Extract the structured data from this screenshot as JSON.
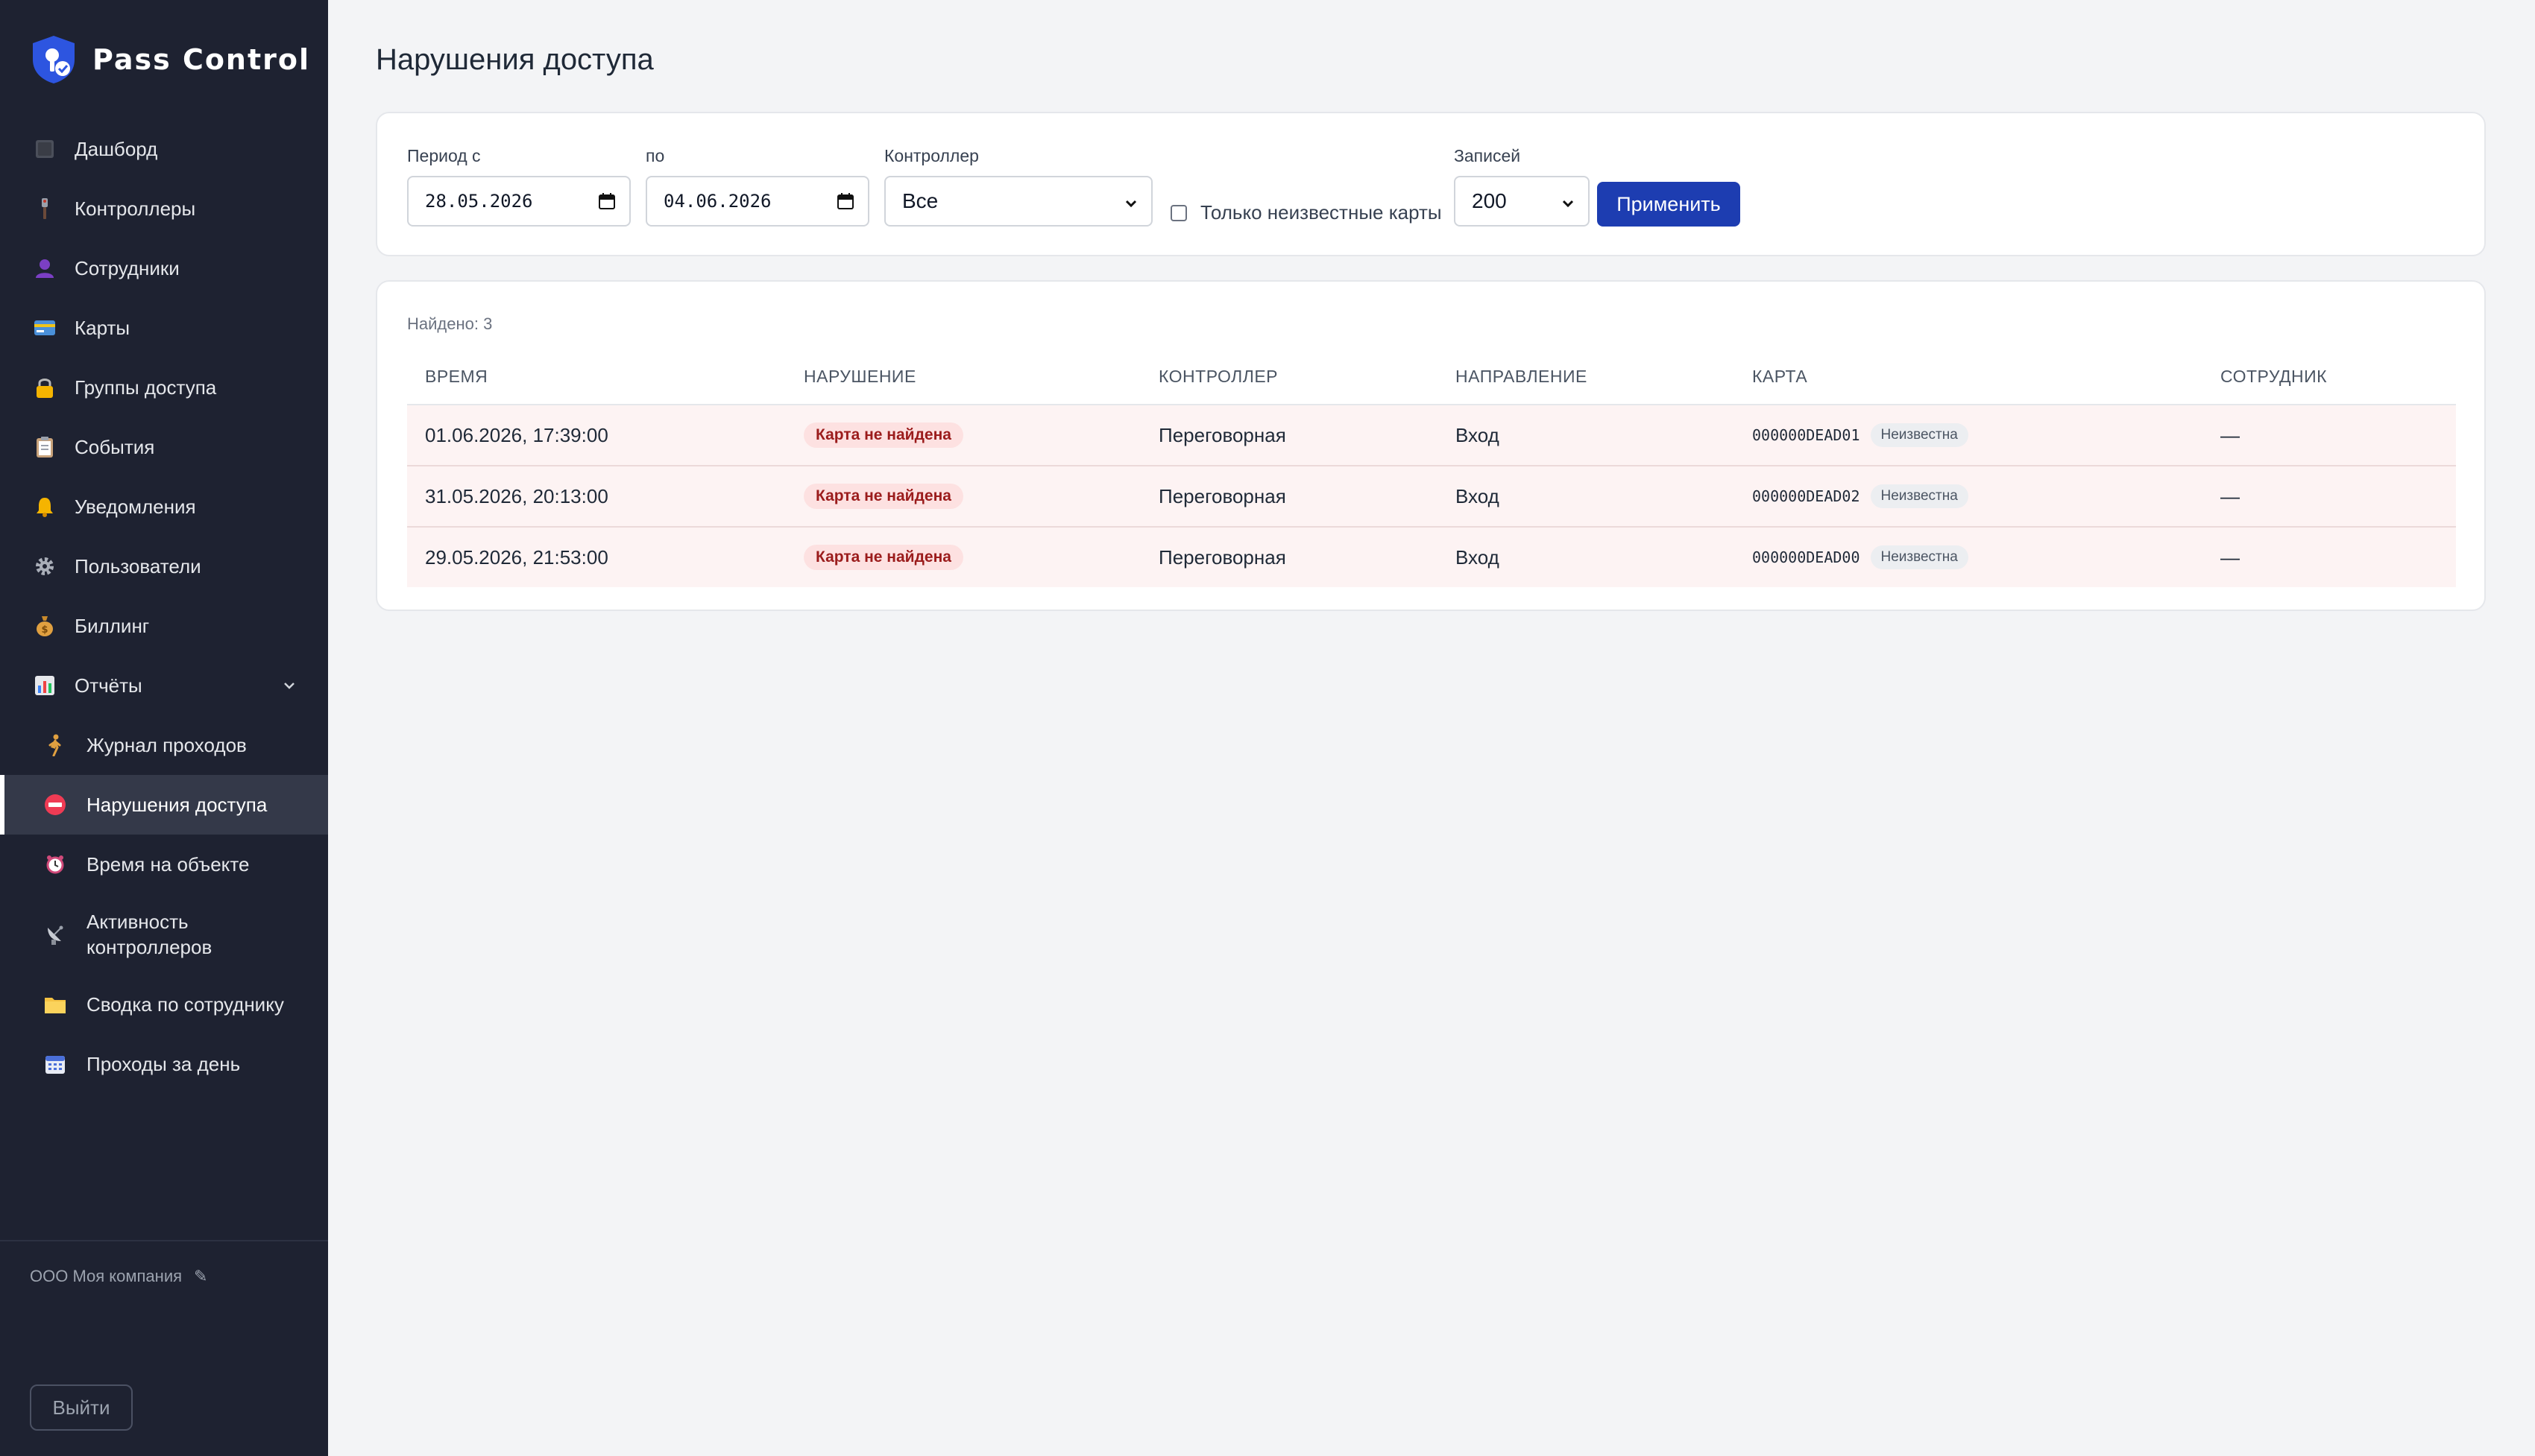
{
  "app": {
    "name": "Pass Control"
  },
  "sidebar": {
    "items": [
      {
        "label": "Дашборд",
        "icon": "dashboard-icon"
      },
      {
        "label": "Контроллеры",
        "icon": "controller-icon"
      },
      {
        "label": "Сотрудники",
        "icon": "user-icon"
      },
      {
        "label": "Карты",
        "icon": "card-icon"
      },
      {
        "label": "Группы доступа",
        "icon": "lock-icon"
      },
      {
        "label": "События",
        "icon": "clipboard-icon"
      },
      {
        "label": "Уведомления",
        "icon": "bell-icon"
      },
      {
        "label": "Пользователи",
        "icon": "gear-icon"
      },
      {
        "label": "Биллинг",
        "icon": "money-bag-icon"
      }
    ],
    "reports": {
      "label": "Отчёты",
      "icon": "bar-chart-icon",
      "expanded": true,
      "items": [
        {
          "label": "Журнал проходов",
          "icon": "walking-person-icon"
        },
        {
          "label": "Нарушения доступа",
          "icon": "no-entry-icon",
          "active": true
        },
        {
          "label": "Время на объекте",
          "icon": "alarm-clock-icon"
        },
        {
          "label": "Активность контроллеров",
          "icon": "satellite-dish-icon"
        },
        {
          "label": "Сводка по сотруднику",
          "icon": "folder-icon"
        },
        {
          "label": "Проходы за день",
          "icon": "calendar-icon"
        }
      ]
    },
    "company": "ООО Моя компания",
    "company_edit_glyph": "✎",
    "logout_label": "Выйти"
  },
  "page": {
    "title": "Нарушения доступа"
  },
  "filters": {
    "period_from_label": "Период с",
    "period_from_value": "28.05.2026",
    "period_to_label": "по",
    "period_to_value": "04.06.2026",
    "controller_label": "Контроллер",
    "controller_value": "Все",
    "unknown_only_label": "Только неизвестные карты",
    "unknown_only_checked": false,
    "records_label": "Записей",
    "records_value": "200",
    "apply_label": "Применить"
  },
  "results": {
    "found_text": "Найдено: 3",
    "columns": [
      "ВРЕМЯ",
      "НАРУШЕНИЕ",
      "КОНТРОЛЛЕР",
      "НАПРАВЛЕНИЕ",
      "КАРТА",
      "СОТРУДНИК"
    ],
    "rows": [
      {
        "time": "01.06.2026, 17:39:00",
        "violation": "Карта не найдена",
        "controller": "Переговорная",
        "direction": "Вход",
        "card": "000000DEAD01",
        "card_status": "Неизвестна",
        "employee": "—"
      },
      {
        "time": "31.05.2026, 20:13:00",
        "violation": "Карта не найдена",
        "controller": "Переговорная",
        "direction": "Вход",
        "card": "000000DEAD02",
        "card_status": "Неизвестна",
        "employee": "—"
      },
      {
        "time": "29.05.2026, 21:53:00",
        "violation": "Карта не найдена",
        "controller": "Переговорная",
        "direction": "Вход",
        "card": "000000DEAD00",
        "card_status": "Неизвестна",
        "employee": "—"
      }
    ]
  },
  "colors": {
    "sidebar_bg": "#1e2231",
    "active_item_bg": "#343949",
    "accent": "#1d3db1",
    "row_highlight": "#fdf3f3",
    "violation_badge_bg": "#fde1e1",
    "violation_badge_text": "#9b1c1c"
  }
}
